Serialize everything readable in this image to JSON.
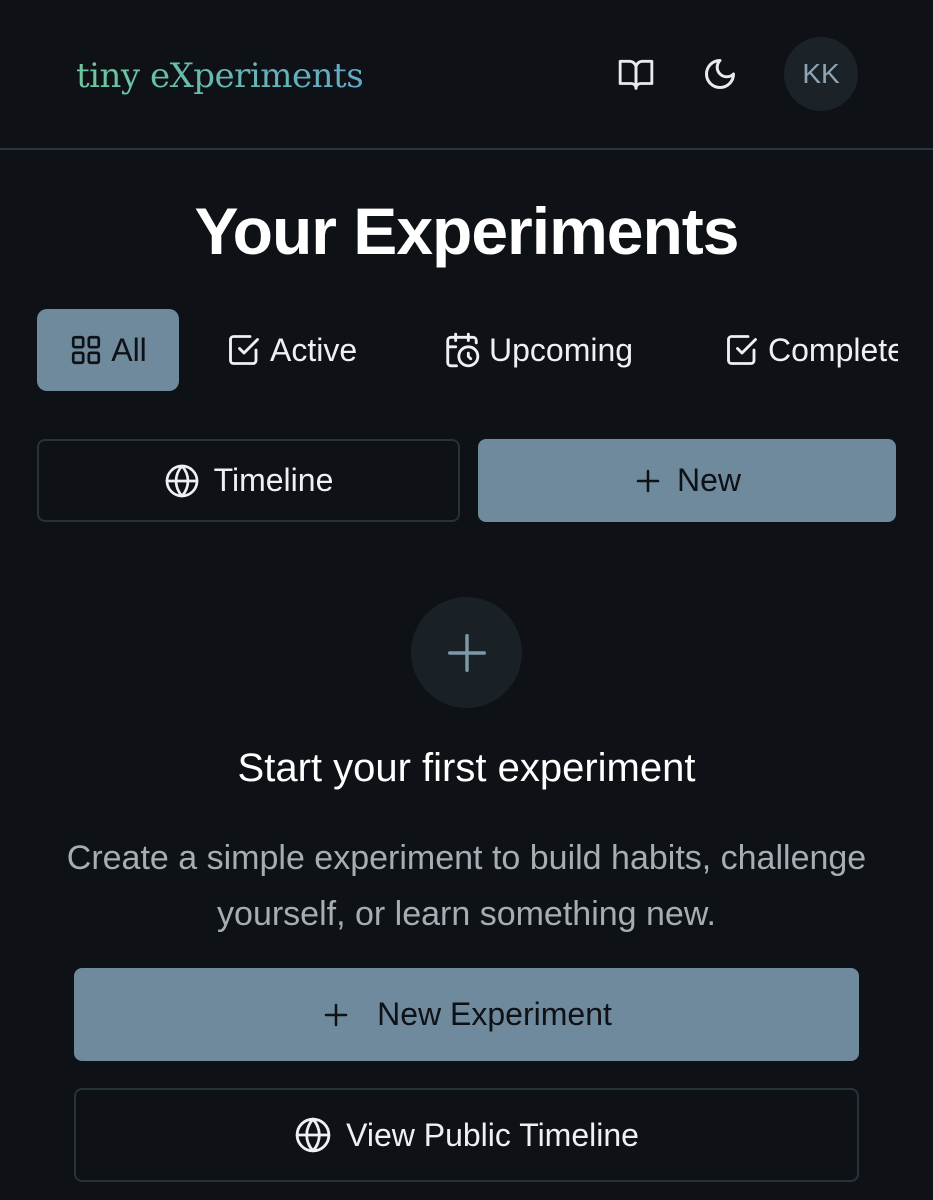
{
  "header": {
    "logo": "tiny eXperiments",
    "avatar_initials": "KK",
    "icons": [
      "book-open-icon",
      "moon-icon"
    ]
  },
  "page_title": "Your Experiments",
  "tabs": [
    {
      "label": "All",
      "icon": "grid-icon",
      "selected": true
    },
    {
      "label": "Active",
      "icon": "check-square-icon",
      "selected": false
    },
    {
      "label": "Upcoming",
      "icon": "calendar-clock-icon",
      "selected": false
    },
    {
      "label": "Completed",
      "icon": "check-square-icon",
      "selected": false
    }
  ],
  "actions": {
    "timeline_label": "Timeline",
    "new_label": "New"
  },
  "empty_state": {
    "title": "Start your first experiment",
    "description": "Create a simple experiment to build habits, challenge yourself, or learn something new.",
    "new_experiment_label": "New Experiment",
    "view_public_timeline_label": "View Public Timeline"
  },
  "colors": {
    "background": "#0e1115",
    "accent": "#6f8a9c",
    "logo_gradient_start": "#6dc79c",
    "logo_gradient_end": "#62a9c7",
    "border": "#27343d"
  }
}
